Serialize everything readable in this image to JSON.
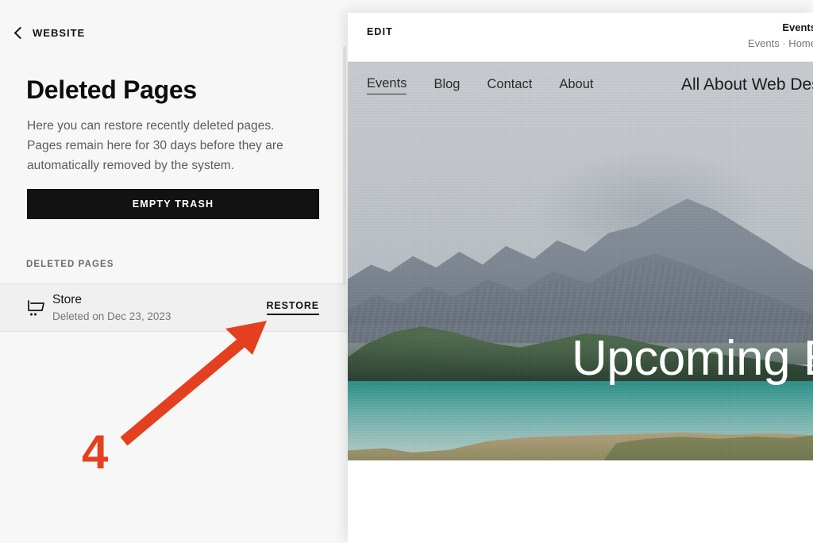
{
  "accent_red": "#e4401f",
  "left_panel": {
    "back": {
      "label": "WEBSITE",
      "icon": "chevron-left-icon"
    },
    "title": "Deleted Pages",
    "description": "Here you can restore recently deleted pages. Pages remain here for 30 days before they are automatically removed by the system.",
    "empty_trash_label": "EMPTY TRASH",
    "section_label": "DELETED PAGES",
    "rows": [
      {
        "icon": "shopping-cart-icon",
        "title": "Store",
        "subtitle": "Deleted on Dec 23, 2023",
        "action_label": "RESTORE"
      }
    ]
  },
  "preview": {
    "edit_label": "EDIT",
    "meta_title": "Events",
    "meta_sub": "Events · Home",
    "site": {
      "nav": [
        {
          "label": "Events",
          "active": true
        },
        {
          "label": "Blog",
          "active": false
        },
        {
          "label": "Contact",
          "active": false
        },
        {
          "label": "About",
          "active": false
        }
      ],
      "brand": "All About Web Design",
      "hero_heading": "Upcoming Events"
    }
  },
  "annotation": {
    "step_number": "4",
    "target": "restore-link"
  }
}
